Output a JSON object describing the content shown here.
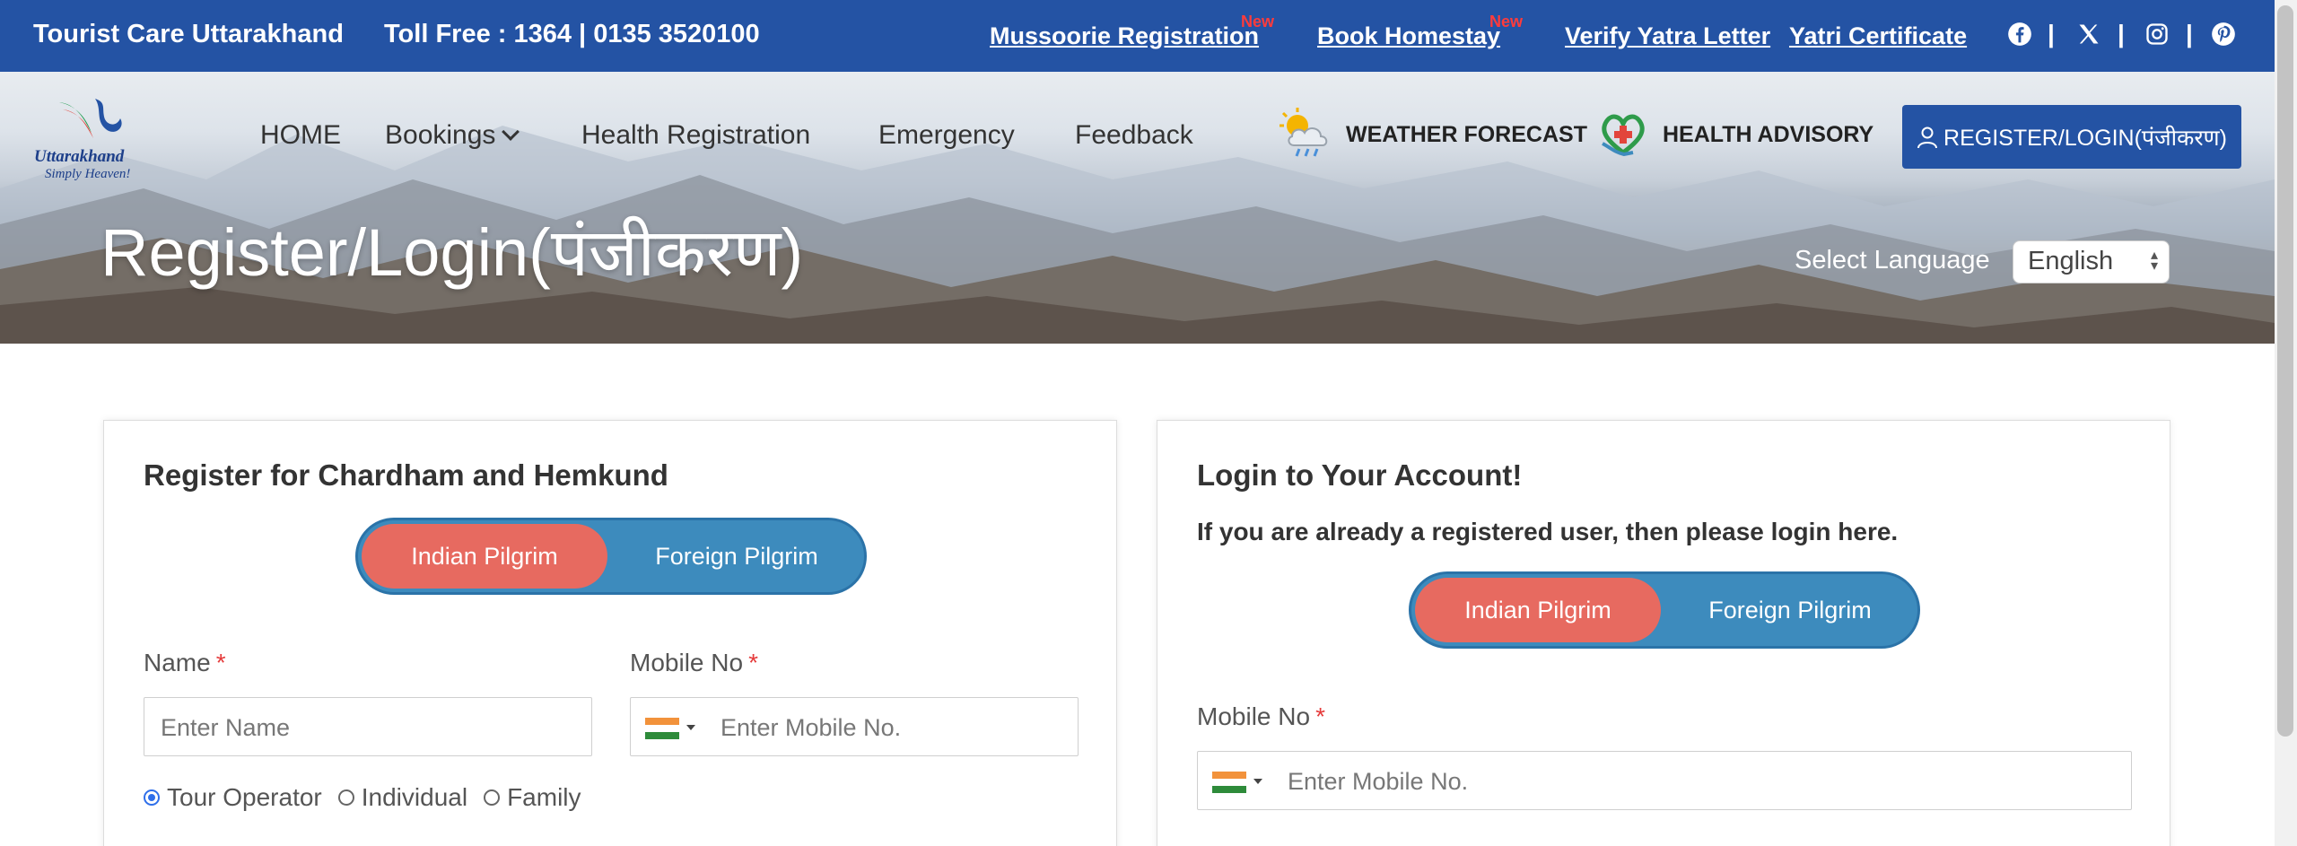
{
  "topbar": {
    "brand": "Tourist Care Uttarakhand",
    "toll_free": "Toll Free : 1364 | 0135 3520100",
    "links": [
      {
        "label": "Mussoorie Registration",
        "badge": "New"
      },
      {
        "label": "Book Homestay",
        "badge": "New"
      },
      {
        "label": "Verify Yatra Letter"
      },
      {
        "label": "Yatri Certificate"
      }
    ],
    "social_icons": [
      "facebook-icon",
      "x-twitter-icon",
      "instagram-icon",
      "pinterest-icon"
    ],
    "separator": "|",
    "colors": {
      "bar": "#2453a4",
      "badge": "#ff3b3b"
    }
  },
  "header": {
    "logo": {
      "word": "Uttarakhand",
      "tagline": "Simply Heaven!"
    },
    "nav": [
      "HOME",
      "Bookings",
      "Health Registration",
      "Emergency",
      "Feedback"
    ],
    "weather": "WEATHER FORECAST",
    "health": "HEALTH ADVISORY",
    "register_button": "REGISTER/LOGIN(पंजीकरण)"
  },
  "hero": {
    "title": "Register/Login(पंजीकरण)",
    "language_label": "Select Language",
    "language_value": "English"
  },
  "register_card": {
    "title": "Register for Chardham and Hemkund",
    "toggle": {
      "active": "Indian Pilgrim",
      "other": "Foreign Pilgrim"
    },
    "name_label": "Name",
    "name_placeholder": "Enter Name",
    "mobile_label": "Mobile No",
    "mobile_placeholder": "Enter  Mobile No.",
    "required_mark": "*",
    "radios": [
      {
        "label": "Tour Operator",
        "checked": true
      },
      {
        "label": "Individual",
        "checked": false
      },
      {
        "label": "Family",
        "checked": false
      }
    ]
  },
  "login_card": {
    "title": "Login to Your Account!",
    "subtitle": "If you are already a registered user, then please login here.",
    "toggle": {
      "active": "Indian Pilgrim",
      "other": "Foreign Pilgrim"
    },
    "mobile_label": "Mobile No",
    "mobile_placeholder": "Enter  Mobile No.",
    "required_mark": "*"
  },
  "colors": {
    "active_toggle": "#e76a60",
    "toggle": "#3d8bbd",
    "primary": "#2453a4"
  }
}
